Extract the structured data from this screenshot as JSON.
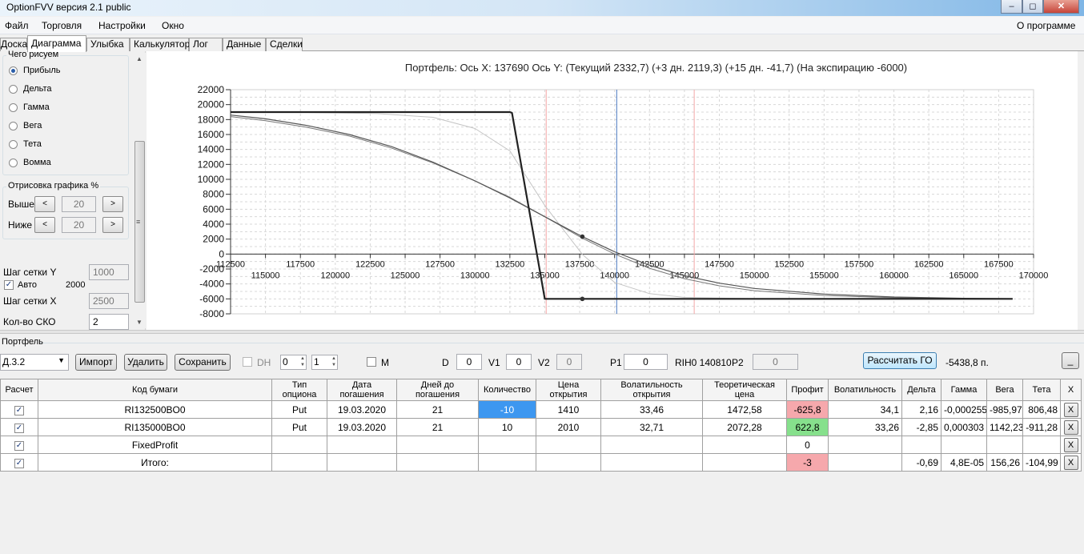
{
  "window": {
    "title": "OptionFVV версия 2.1 public",
    "controls": [
      "‒",
      "◻",
      "✕"
    ]
  },
  "menu": {
    "items": [
      "Файл",
      "Торговля",
      "Настройки",
      "Окно"
    ],
    "about": "О программе"
  },
  "tabs": [
    "Доска",
    "Диаграмма",
    "Улыбка",
    "Калькулятор",
    "Лог",
    "Данные",
    "Сделки"
  ],
  "active_tab": "Диаграмма",
  "left_panel": {
    "what_title": "Чего рисуем",
    "what_options": [
      "Прибыль",
      "Дельта",
      "Гамма",
      "Вега",
      "Тета",
      "Вомма"
    ],
    "what_selected": "Прибыль",
    "render_title": "Отрисовка графика %",
    "above_label": "Выше",
    "above_value": "20",
    "below_label": "Ниже",
    "below_value": "20",
    "prev": "<",
    "next": ">",
    "grid_y_label": "Шаг сетки Y",
    "grid_y_value": "1000",
    "auto_label": "Авто",
    "auto_value": "2000",
    "grid_x_label": "Шаг сетки X",
    "grid_x_value": "2500",
    "sko_label": "Кол-во СКО",
    "sko_value": "2"
  },
  "chart_data": {
    "type": "line",
    "title": "Портфель: Ось X:  137690 Ось Y:  (Текущий 2332,7)  (+3 дн. 2119,3)  (+15 дн. -41,7)  (На экспирацию -6000)",
    "xlim": [
      112500,
      170000
    ],
    "ylim": [
      -8000,
      22000
    ],
    "yticks": [
      22000,
      20000,
      18000,
      16000,
      14000,
      12000,
      10000,
      8000,
      6000,
      4000,
      2000,
      0,
      -2000,
      -4000,
      -6000,
      -8000
    ],
    "xticks_upper": [
      112500,
      117500,
      122500,
      127500,
      132500,
      137500,
      142500,
      147500,
      152500,
      157500,
      162500,
      167500
    ],
    "xticks_lower": [
      115000,
      120000,
      125000,
      130000,
      135000,
      140000,
      145000,
      150000,
      155000,
      160000,
      165000,
      170000
    ],
    "vlines": [
      {
        "x": 135100,
        "color": "#f4a6a6"
      },
      {
        "x": 140150,
        "color": "#4a78c0"
      },
      {
        "x": 145700,
        "color": "#f4a6a6"
      }
    ],
    "markers": [
      {
        "x": 137690,
        "y": 2332
      },
      {
        "x": 137690,
        "y": -6000
      }
    ],
    "series": [
      {
        "color": "#222222",
        "width": 2.2,
        "points": [
          [
            112500,
            19000
          ],
          [
            132500,
            19000
          ],
          [
            132650,
            18900
          ],
          [
            135000,
            -6000
          ],
          [
            168500,
            -6000
          ]
        ]
      },
      {
        "color": "#555555",
        "width": 1.2,
        "points": [
          [
            112500,
            18600
          ],
          [
            115000,
            18100
          ],
          [
            118000,
            17200
          ],
          [
            121000,
            16000
          ],
          [
            124000,
            14400
          ],
          [
            127000,
            12300
          ],
          [
            130000,
            9800
          ],
          [
            132500,
            7500
          ],
          [
            135000,
            5000
          ],
          [
            137690,
            2332
          ],
          [
            140000,
            300
          ],
          [
            142500,
            -1500
          ],
          [
            145000,
            -2900
          ],
          [
            147500,
            -3900
          ],
          [
            150000,
            -4600
          ],
          [
            155000,
            -5350
          ],
          [
            160000,
            -5750
          ],
          [
            165000,
            -5920
          ],
          [
            168500,
            -5970
          ]
        ]
      },
      {
        "color": "#777777",
        "width": 1.0,
        "points": [
          [
            112500,
            18400
          ],
          [
            115000,
            17850
          ],
          [
            118000,
            16950
          ],
          [
            121000,
            15800
          ],
          [
            124000,
            14200
          ],
          [
            127000,
            12200
          ],
          [
            130000,
            9800
          ],
          [
            132500,
            7600
          ],
          [
            135000,
            5000
          ],
          [
            137690,
            2119
          ],
          [
            140000,
            0
          ],
          [
            142500,
            -1900
          ],
          [
            145000,
            -3300
          ],
          [
            147500,
            -4250
          ],
          [
            150000,
            -4900
          ],
          [
            155000,
            -5550
          ],
          [
            160000,
            -5850
          ],
          [
            165000,
            -5960
          ],
          [
            168500,
            -5990
          ]
        ]
      },
      {
        "color": "#c4c4c4",
        "width": 1.0,
        "points": [
          [
            112500,
            19000
          ],
          [
            118000,
            18950
          ],
          [
            123000,
            18800
          ],
          [
            127000,
            18300
          ],
          [
            130000,
            16800
          ],
          [
            132500,
            13800
          ],
          [
            135000,
            6500
          ],
          [
            137690,
            -42
          ],
          [
            140000,
            -3800
          ],
          [
            142500,
            -5300
          ],
          [
            145000,
            -5800
          ],
          [
            150000,
            -5980
          ],
          [
            168500,
            -6000
          ]
        ]
      }
    ]
  },
  "portfolio": {
    "group_label": "Портфель",
    "selected_portfolio": "Д.3.2",
    "import": "Импорт",
    "delete": "Удалить",
    "save": "Сохранить",
    "dh_label": "DH",
    "spin1": "0",
    "spin2": "1",
    "m_label": "M",
    "d_label": "D",
    "d_value": "0",
    "v1_label": "V1",
    "v1_value": "0",
    "v2_label": "V2",
    "v2_value": "0",
    "p1_label": "P1",
    "p1_value": "0",
    "instrument": "RIH0 140810",
    "p2_label": "P2",
    "p2_value": "0",
    "calc_go": "Рассчитать ГО",
    "go_value": "-5438,8 п.",
    "minimize": "_"
  },
  "table": {
    "headers": [
      "Расчет",
      "Код бумаги",
      "Тип\nопциона",
      "Дата\nпогашения",
      "Дней до\nпогашения",
      "Количество",
      "Цена\nоткрытия",
      "Волатильность\nоткрытия",
      "Теоретическая\nцена",
      "Профит",
      "Волатильность",
      "Дельта",
      "Гамма",
      "Вега",
      "Тета",
      "X"
    ],
    "rows": [
      [
        "✓",
        "RI132500BO0",
        "Put",
        "19.03.2020",
        "21",
        "-10",
        "1410",
        "33,46",
        "1472,58",
        "-625,8",
        "34,1",
        "2,16",
        "-0,000255",
        "-985,97",
        "806,48",
        "X"
      ],
      [
        "✓",
        "RI135000BO0",
        "Put",
        "19.03.2020",
        "21",
        "10",
        "2010",
        "32,71",
        "2072,28",
        "622,8",
        "33,26",
        "-2,85",
        "0,000303",
        "1142,23",
        "-911,28",
        "X"
      ],
      [
        "✓",
        "FixedProfit",
        "",
        "",
        "",
        "",
        "",
        "",
        "",
        "0",
        "",
        "",
        "",
        "",
        "",
        "X"
      ],
      [
        "✓",
        "Итого:",
        "",
        "",
        "",
        "",
        "",
        "",
        "",
        "-3",
        "",
        "-0,69",
        "4,8E-05",
        "156,26",
        "-104,99",
        "X"
      ]
    ]
  }
}
